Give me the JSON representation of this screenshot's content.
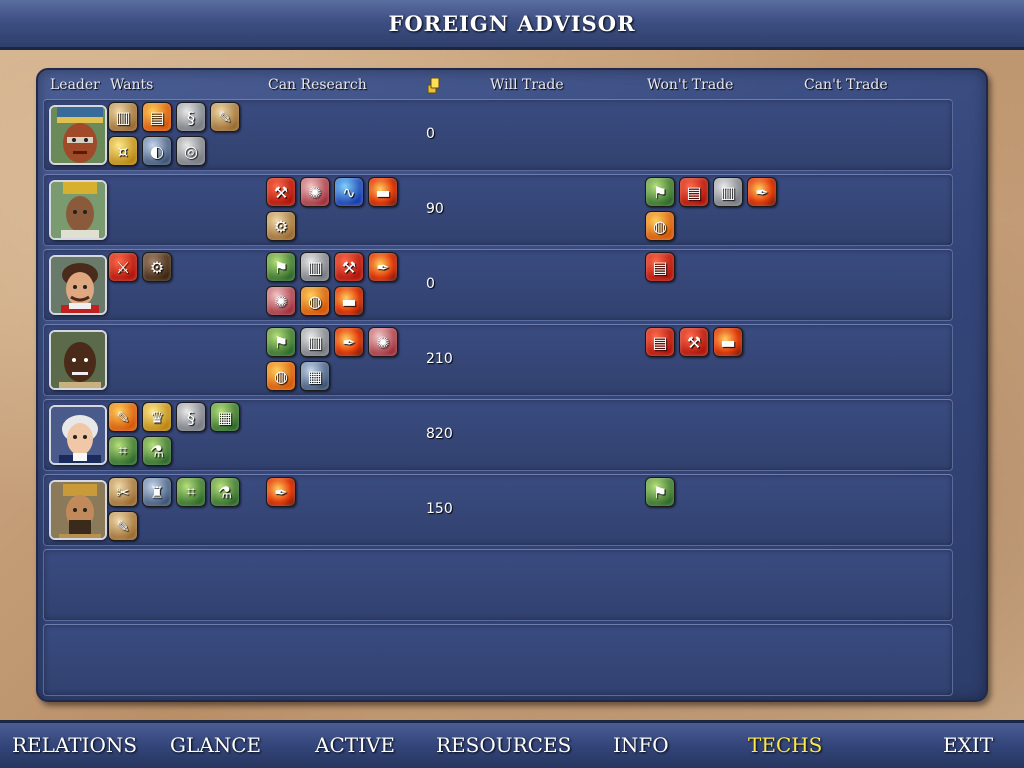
{
  "window": {
    "title": "FOREIGN ADVISOR"
  },
  "columns": {
    "leader": "Leader",
    "wants": "Wants",
    "can_research": "Can Research",
    "gold_icon": "gold-coins-icon",
    "will_trade": "Will Trade",
    "wont_trade": "Won't Trade",
    "cant_trade": "Can't Trade"
  },
  "rows": [
    {
      "leader_icon": "leader-portrait-aztec",
      "gold": "0",
      "wants": [
        "t-tan",
        "t-orange",
        "t-grey",
        "t-tan",
        "t-gold",
        "t-steel",
        "t-grey"
      ],
      "can_research": [],
      "wont_trade": []
    },
    {
      "leader_icon": "leader-portrait-inca",
      "gold": "90",
      "wants": [],
      "can_research": [
        "t-red",
        "t-pink",
        "t-blue",
        "t-fire",
        "t-tan"
      ],
      "wont_trade": [
        "t-green",
        "t-red",
        "t-grey",
        "t-fire",
        "t-orange"
      ]
    },
    {
      "leader_icon": "leader-portrait-europe",
      "gold": "0",
      "wants": [
        "t-red",
        "t-dark"
      ],
      "can_research": [
        "t-green",
        "t-grey",
        "t-red",
        "t-fire",
        "t-pink",
        "t-orange",
        "t-fire"
      ],
      "wont_trade": [
        "t-red"
      ]
    },
    {
      "leader_icon": "leader-portrait-zulu",
      "gold": "210",
      "wants": [],
      "can_research": [
        "t-green",
        "t-grey",
        "t-fire",
        "t-pink",
        "t-orange",
        "t-steel"
      ],
      "wont_trade": [
        "t-red",
        "t-red",
        "t-fire"
      ]
    },
    {
      "leader_icon": "leader-portrait-washington",
      "gold": "820",
      "wants": [
        "t-orange",
        "t-gold",
        "t-grey",
        "t-green",
        "t-green",
        "t-green"
      ],
      "can_research": [],
      "wont_trade": []
    },
    {
      "leader_icon": "leader-portrait-babylon",
      "gold": "150",
      "wants": [
        "t-tan",
        "t-steel",
        "t-green",
        "t-green",
        "t-tan"
      ],
      "can_research": [
        "t-fire"
      ],
      "wont_trade": [
        "t-green"
      ]
    }
  ],
  "nav": {
    "relations": "RELATIONS",
    "glance": "GLANCE",
    "active": "ACTIVE",
    "resources": "RESOURCES",
    "info": "INFO",
    "techs": "TECHS",
    "exit": "EXIT"
  },
  "colors": {
    "active_tab": "#ffe94a",
    "panel_blue": "#34467a",
    "parchment": "#c9a27a"
  }
}
